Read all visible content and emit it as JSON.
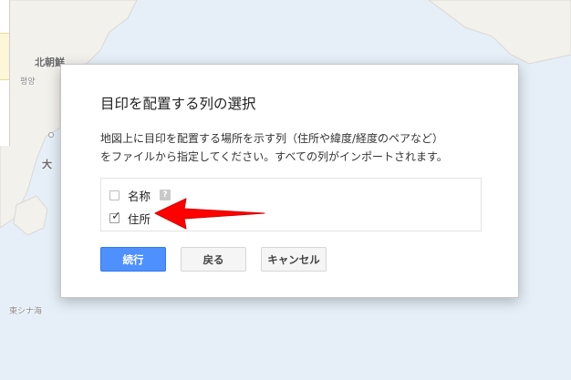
{
  "map": {
    "labels": {
      "north_korea": "北朝鮮",
      "pyongyang": "평양",
      "osaka_fragment": "大",
      "east_china_sea": "東シナ海"
    }
  },
  "dialog": {
    "title": "目印を配置する列の選択",
    "description_line1": "地図上に目印を配置する場所を示す列（住所や緯度/経度のペアなど）",
    "description_line2": "をファイルから指定してください。すべての列がインポートされます。",
    "columns": [
      {
        "label": "名称",
        "checked": false,
        "help_icon": "help-icon"
      },
      {
        "label": "住所",
        "checked": true
      }
    ],
    "buttons": {
      "continue": "続行",
      "back": "戻る",
      "cancel": "キャンセル"
    },
    "help_glyph": "?"
  },
  "colors": {
    "primary_button": "#4d90fe",
    "annotation_arrow": "#ff0000",
    "map_water": "#e6eff8"
  }
}
